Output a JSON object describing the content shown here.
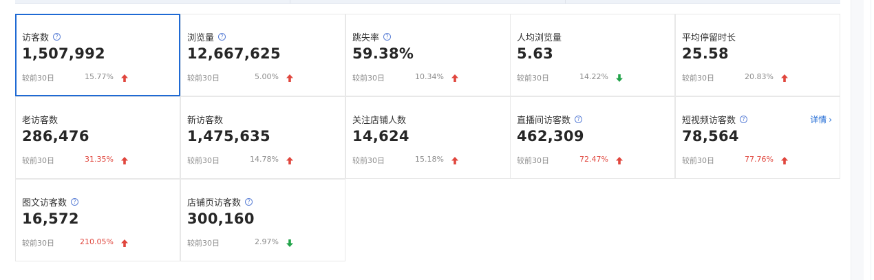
{
  "compare_label": "较前30日",
  "detail_label": "详情",
  "colors": {
    "up": "#e0463d",
    "down": "#22a34a",
    "accent": "#1f6ad4"
  },
  "metrics": [
    {
      "title": "访客数",
      "help": true,
      "value": "1,507,992",
      "pct": "15.77%",
      "dir": "up",
      "pct_highlight": false,
      "selected": true
    },
    {
      "title": "浏览量",
      "help": true,
      "value": "12,667,625",
      "pct": "5.00%",
      "dir": "up",
      "pct_highlight": false
    },
    {
      "title": "跳失率",
      "help": true,
      "value": "59.38%",
      "pct": "10.34%",
      "dir": "up",
      "pct_highlight": false
    },
    {
      "title": "人均浏览量",
      "help": false,
      "value": "5.63",
      "pct": "14.22%",
      "dir": "down",
      "pct_highlight": false
    },
    {
      "title": "平均停留时长",
      "help": false,
      "value": "25.58",
      "pct": "20.83%",
      "dir": "up",
      "pct_highlight": false
    },
    {
      "title": "老访客数",
      "help": false,
      "value": "286,476",
      "pct": "31.35%",
      "dir": "up",
      "pct_highlight": true
    },
    {
      "title": "新访客数",
      "help": false,
      "value": "1,475,635",
      "pct": "14.78%",
      "dir": "up",
      "pct_highlight": false
    },
    {
      "title": "关注店铺人数",
      "help": false,
      "value": "14,624",
      "pct": "15.18%",
      "dir": "up",
      "pct_highlight": false
    },
    {
      "title": "直播间访客数",
      "help": true,
      "value": "462,309",
      "pct": "72.47%",
      "dir": "up",
      "pct_highlight": true
    },
    {
      "title": "短视频访客数",
      "help": true,
      "value": "78,564",
      "pct": "77.76%",
      "dir": "up",
      "pct_highlight": true,
      "detail": true
    },
    {
      "title": "图文访客数",
      "help": true,
      "value": "16,572",
      "pct": "210.05%",
      "dir": "up",
      "pct_highlight": true
    },
    {
      "title": "店铺页访客数",
      "help": true,
      "value": "300,160",
      "pct": "2.97%",
      "dir": "down",
      "pct_highlight": false
    }
  ]
}
